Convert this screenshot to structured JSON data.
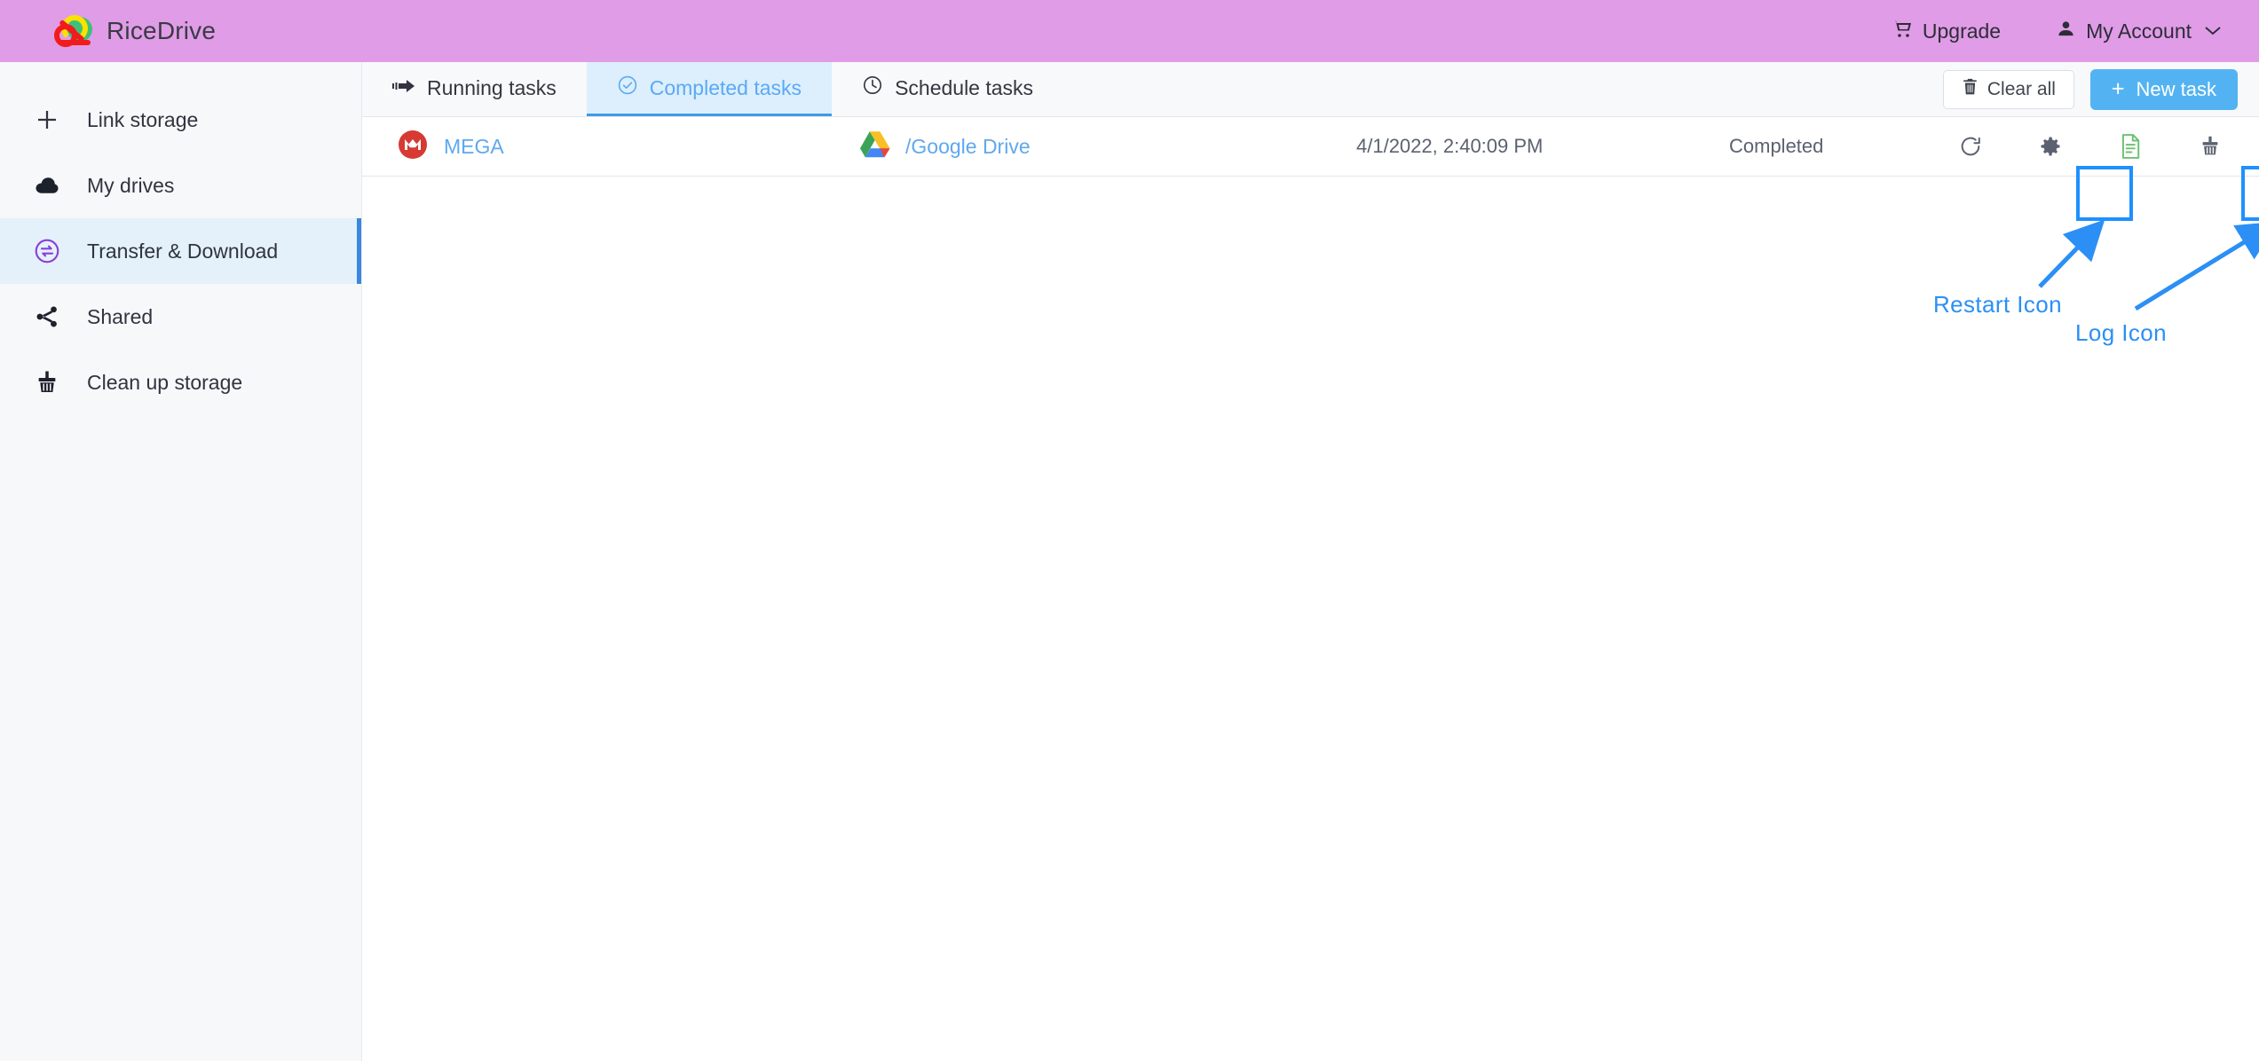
{
  "header": {
    "brand": "RiceDrive",
    "logo_icon": "ricedrive-cloud-logo",
    "upgrade_label": "Upgrade",
    "upgrade_icon": "cart-icon",
    "account_label": "My Account",
    "account_icon": "user-icon",
    "chevron_icon": "chevron-down-icon",
    "background_color": "#e09ce6"
  },
  "sidebar": {
    "background_color": "#f7f8fa",
    "active_background": "#e4f1fb",
    "active_accent": "#3b87e0",
    "items": [
      {
        "label": "Link storage",
        "icon": "plus-icon",
        "active": false
      },
      {
        "label": "My drives",
        "icon": "cloud-icon",
        "active": false
      },
      {
        "label": "Transfer & Download",
        "icon": "transfer-circle-icon",
        "active": true
      },
      {
        "label": "Shared",
        "icon": "share-nodes-icon",
        "active": false
      },
      {
        "label": "Clean up storage",
        "icon": "broom-icon",
        "active": false
      }
    ]
  },
  "main": {
    "tabs": [
      {
        "label": "Running tasks",
        "icon": "arrow-right-motion-icon",
        "active": false
      },
      {
        "label": "Completed tasks",
        "icon": "check-circle-icon",
        "active": true
      },
      {
        "label": "Schedule tasks",
        "icon": "clock-icon",
        "active": false
      }
    ],
    "toolbar": {
      "clear_all_label": "Clear all",
      "clear_all_icon": "trash-icon",
      "new_task_label": "New task",
      "new_task_plus": "+",
      "new_task_color": "#53b3f2"
    },
    "tasks": [
      {
        "source_name": "MEGA",
        "source_icon": "mega-icon",
        "destination_name": "/Google Drive",
        "destination_icon": "google-drive-icon",
        "time": "4/1/2022, 2:40:09 PM",
        "status": "Completed",
        "actions": [
          {
            "name": "restart",
            "icon": "restart-icon",
            "color": "#5b6170"
          },
          {
            "name": "settings",
            "icon": "gear-icon",
            "color": "#5b6170"
          },
          {
            "name": "log",
            "icon": "log-file-icon",
            "color": "#6cc070"
          },
          {
            "name": "clean",
            "icon": "broom-icon",
            "color": "#5b6170"
          }
        ]
      }
    ]
  },
  "annotations": {
    "color": "#2b8ff5",
    "items": [
      {
        "label": "Restart Icon"
      },
      {
        "label": "Log Icon"
      }
    ]
  }
}
